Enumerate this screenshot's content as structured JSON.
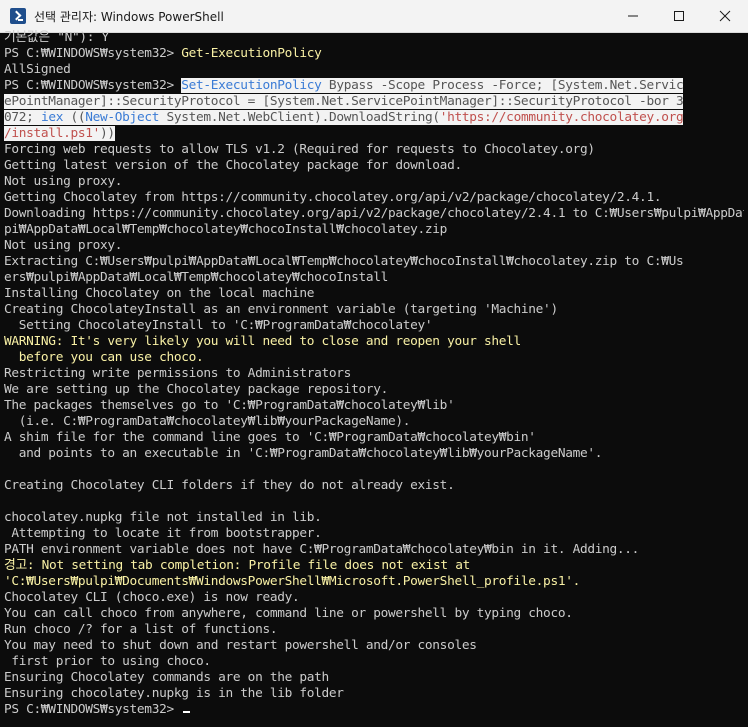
{
  "window": {
    "title": "선택 관리자: Windows PowerShell"
  },
  "console": {
    "line_0": "기본값은 \"N\"): Y",
    "prompt_1": "PS C:₩WINDOWS₩system32> ",
    "cmd_1": "Get-ExecutionPolicy",
    "line_2": "AllSigned",
    "prompt_3": "PS C:₩WINDOWS₩system32> ",
    "sel_3a": "Set-ExecutionPolicy",
    "sel_3b": " Bypass ",
    "sel_3c": "-Scope",
    "sel_3d": " Process ",
    "sel_3e": "-Force",
    "sel_3f": "; [System.Net.Servic",
    "sel_4": "ePointManager]::SecurityProtocol = [System.Net.ServicePointManager]::SecurityProtocol -bor 3",
    "sel_5a": "072; ",
    "sel_5b": "iex",
    "sel_5c": " ((",
    "sel_5d": "New-Object",
    "sel_5e": " System.Net.WebClient).DownloadString(",
    "sel_5f": "'https://community.chocolatey.org",
    "sel_6a": "/install.ps1'",
    "sel_6b": "))",
    "lines_a": [
      "Forcing web requests to allow TLS v1.2 (Required for requests to Chocolatey.org)",
      "Getting latest version of the Chocolatey package for download.",
      "Not using proxy.",
      "Getting Chocolatey from https://community.chocolatey.org/api/v2/package/chocolatey/2.4.1.",
      "Downloading https://community.chocolatey.org/api/v2/package/chocolatey/2.4.1 to C:₩Users₩pulpi₩AppData₩Local₩Temp₩chocolatey₩chocoInstall₩chocolatey.zip",
      "pi₩AppData₩Local₩Temp₩chocolatey₩chocoInstall₩chocolatey.zip",
      "Not using proxy.",
      "Extracting C:₩Users₩pulpi₩AppData₩Local₩Temp₩chocolatey₩chocoInstall₩chocolatey.zip to C:₩Us",
      "ers₩pulpi₩AppData₩Local₩Temp₩chocolatey₩chocoInstall",
      "Installing Chocolatey on the local machine",
      "Creating ChocolateyInstall as an environment variable (targeting 'Machine')",
      "  Setting ChocolateyInstall to 'C:₩ProgramData₩chocolatey'"
    ],
    "warn_1": "WARNING: It's very likely you will need to close and reopen your shell",
    "warn_2": "  before you can use choco.",
    "lines_b": [
      "Restricting write permissions to Administrators",
      "We are setting up the Chocolatey package repository.",
      "The packages themselves go to 'C:₩ProgramData₩chocolatey₩lib'",
      "  (i.e. C:₩ProgramData₩chocolatey₩lib₩yourPackageName).",
      "A shim file for the command line goes to 'C:₩ProgramData₩chocolatey₩bin'",
      "  and points to an executable in 'C:₩ProgramData₩chocolatey₩lib₩yourPackageName'.",
      "",
      "Creating Chocolatey CLI folders if they do not already exist.",
      "",
      "chocolatey.nupkg file not installed in lib.",
      " Attempting to locate it from bootstrapper.",
      "PATH environment variable does not have C:₩ProgramData₩chocolatey₩bin in it. Adding..."
    ],
    "warn_3": "경고: Not setting tab completion: Profile file does not exist at",
    "warn_4": "'C:₩Users₩pulpi₩Documents₩WindowsPowerShell₩Microsoft.PowerShell_profile.ps1'.",
    "lines_c": [
      "Chocolatey CLI (choco.exe) is now ready.",
      "You can call choco from anywhere, command line or powershell by typing choco.",
      "Run choco /? for a list of functions.",
      "You may need to shut down and restart powershell and/or consoles",
      " first prior to using choco.",
      "Ensuring Chocolatey commands are on the path",
      "Ensuring chocolatey.nupkg is in the lib folder"
    ],
    "prompt_final": "PS C:₩WINDOWS₩system32> "
  }
}
